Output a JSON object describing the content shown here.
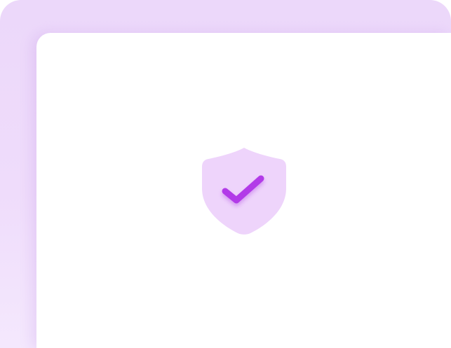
{
  "colors": {
    "frame_background": "#ecd8fa",
    "panel_background": "#ffffff",
    "shield_fill": "#eed4fb",
    "check_stroke": "#b23be8"
  },
  "icons": {
    "main": "shield-check-icon"
  }
}
